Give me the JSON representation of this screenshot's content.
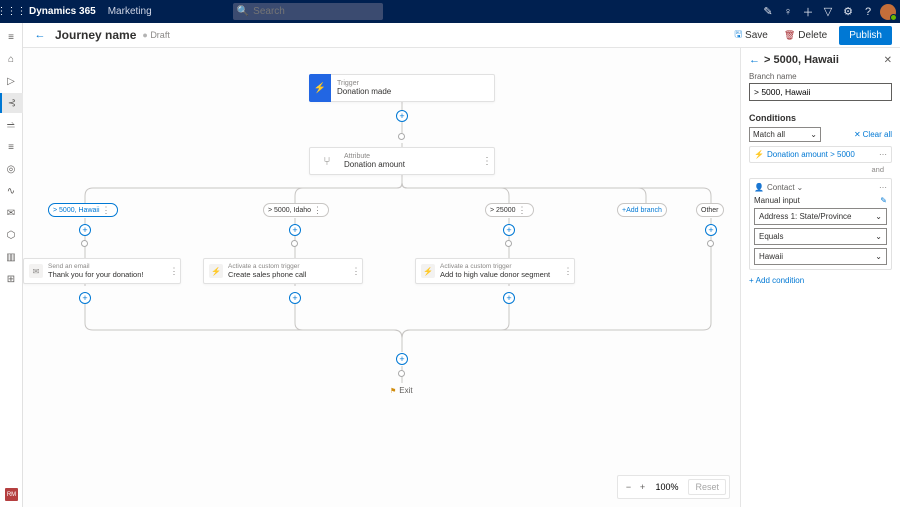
{
  "topbar": {
    "appname": "Dynamics 365",
    "area": "Marketing",
    "search_placeholder": "Search",
    "icons": [
      "edit",
      "bulb",
      "plus",
      "filter",
      "gear",
      "help"
    ]
  },
  "commandbar": {
    "title": "Journey name",
    "status": "Draft",
    "save_label": "Save",
    "delete_label": "Delete",
    "publish_label": "Publish"
  },
  "canvas": {
    "trigger": {
      "type": "Trigger",
      "label": "Donation made"
    },
    "attribute": {
      "type": "Attribute",
      "label": "Donation amount"
    },
    "branches": [
      {
        "label": "> 5000, Hawaii",
        "selected": true
      },
      {
        "label": "> 5000, Idaho"
      },
      {
        "label": "> 25000"
      }
    ],
    "add_branch_label": "Add branch",
    "other_label": "Other",
    "actions": [
      {
        "type": "Send an email",
        "label": "Thank you for your donation!"
      },
      {
        "type": "Activate a custom trigger",
        "label": "Create sales phone call"
      },
      {
        "type": "Activate a custom trigger",
        "label": "Add to high value donor segment"
      }
    ],
    "exit_label": "Exit",
    "zoom": {
      "percent": "100%",
      "reset": "Reset"
    }
  },
  "panel": {
    "title": "> 5000, Hawaii",
    "branch_name_label": "Branch name",
    "branch_name_value": "> 5000, Hawaii",
    "conditions_label": "Conditions",
    "match_all": "Match all",
    "clear_all": "Clear all",
    "condition1": "Donation amount > 5000",
    "and_label": "and",
    "contact_label": "Contact",
    "manual_input_label": "Manual input",
    "field_dropdown": "Address 1: State/Province",
    "operator_dropdown": "Equals",
    "value_dropdown": "Hawaii",
    "add_condition_label": "Add condition"
  }
}
